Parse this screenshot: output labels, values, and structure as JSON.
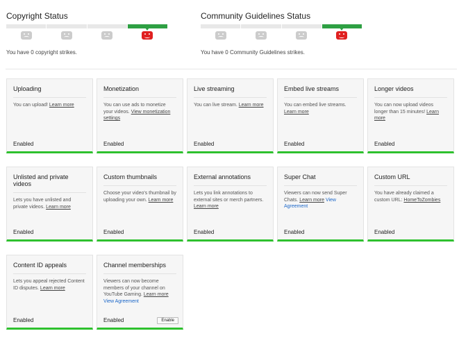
{
  "copyright": {
    "title": "Copyright Status",
    "text": "You have 0 copyright strikes."
  },
  "community": {
    "title": "Community Guidelines Status",
    "text": "You have 0 Community Guidelines strikes."
  },
  "colors": {
    "accent_green": "#2ec12e",
    "strike_red": "#e02020",
    "link_blue": "#1a66c8"
  },
  "features": [
    {
      "title": "Uploading",
      "desc": "You can upload! ",
      "link": "Learn more",
      "status": "Enabled"
    },
    {
      "title": "Monetization",
      "desc": "You can use ads to monetize your videos. ",
      "link": "View monetization settings",
      "status": "Enabled"
    },
    {
      "title": "Live streaming",
      "desc": "You can live stream. ",
      "link": "Learn more",
      "status": "Enabled"
    },
    {
      "title": "Embed live streams",
      "desc": "You can embed live streams. ",
      "link": "Learn more",
      "status": "Enabled"
    },
    {
      "title": "Longer videos",
      "desc": "You can now upload videos longer than 15 minutes! ",
      "link": "Learn more",
      "status": "Enabled"
    },
    {
      "title": "Unlisted and private videos",
      "desc": "Lets you have unlisted and private videos. ",
      "link": "Learn more",
      "status": "Enabled"
    },
    {
      "title": "Custom thumbnails",
      "desc": "Choose your video's thumbnail by uploading your own. ",
      "link": "Learn more",
      "status": "Enabled"
    },
    {
      "title": "External annotations",
      "desc": "Lets you link annotations to external sites or merch partners. ",
      "link": "Learn more",
      "status": "Enabled"
    },
    {
      "title": "Super Chat",
      "desc": "Viewers can now send Super Chats. ",
      "link": "Learn more",
      "link2": "View Agreement",
      "status": "Enabled"
    },
    {
      "title": "Custom URL",
      "desc": "You have already claimed a custom URL: ",
      "link": "HomeToZombies",
      "status": "Enabled"
    },
    {
      "title": "Content ID appeals",
      "desc": "Lets you appeal rejected Content ID disputes. ",
      "link": "Learn more",
      "status": "Enabled"
    },
    {
      "title": "Channel memberships",
      "desc": "Viewers can now become members of your channel on YouTube Gaming. ",
      "link": "Learn more",
      "link2": "View Agreement",
      "status": "Enabled",
      "button": "Enable"
    }
  ]
}
